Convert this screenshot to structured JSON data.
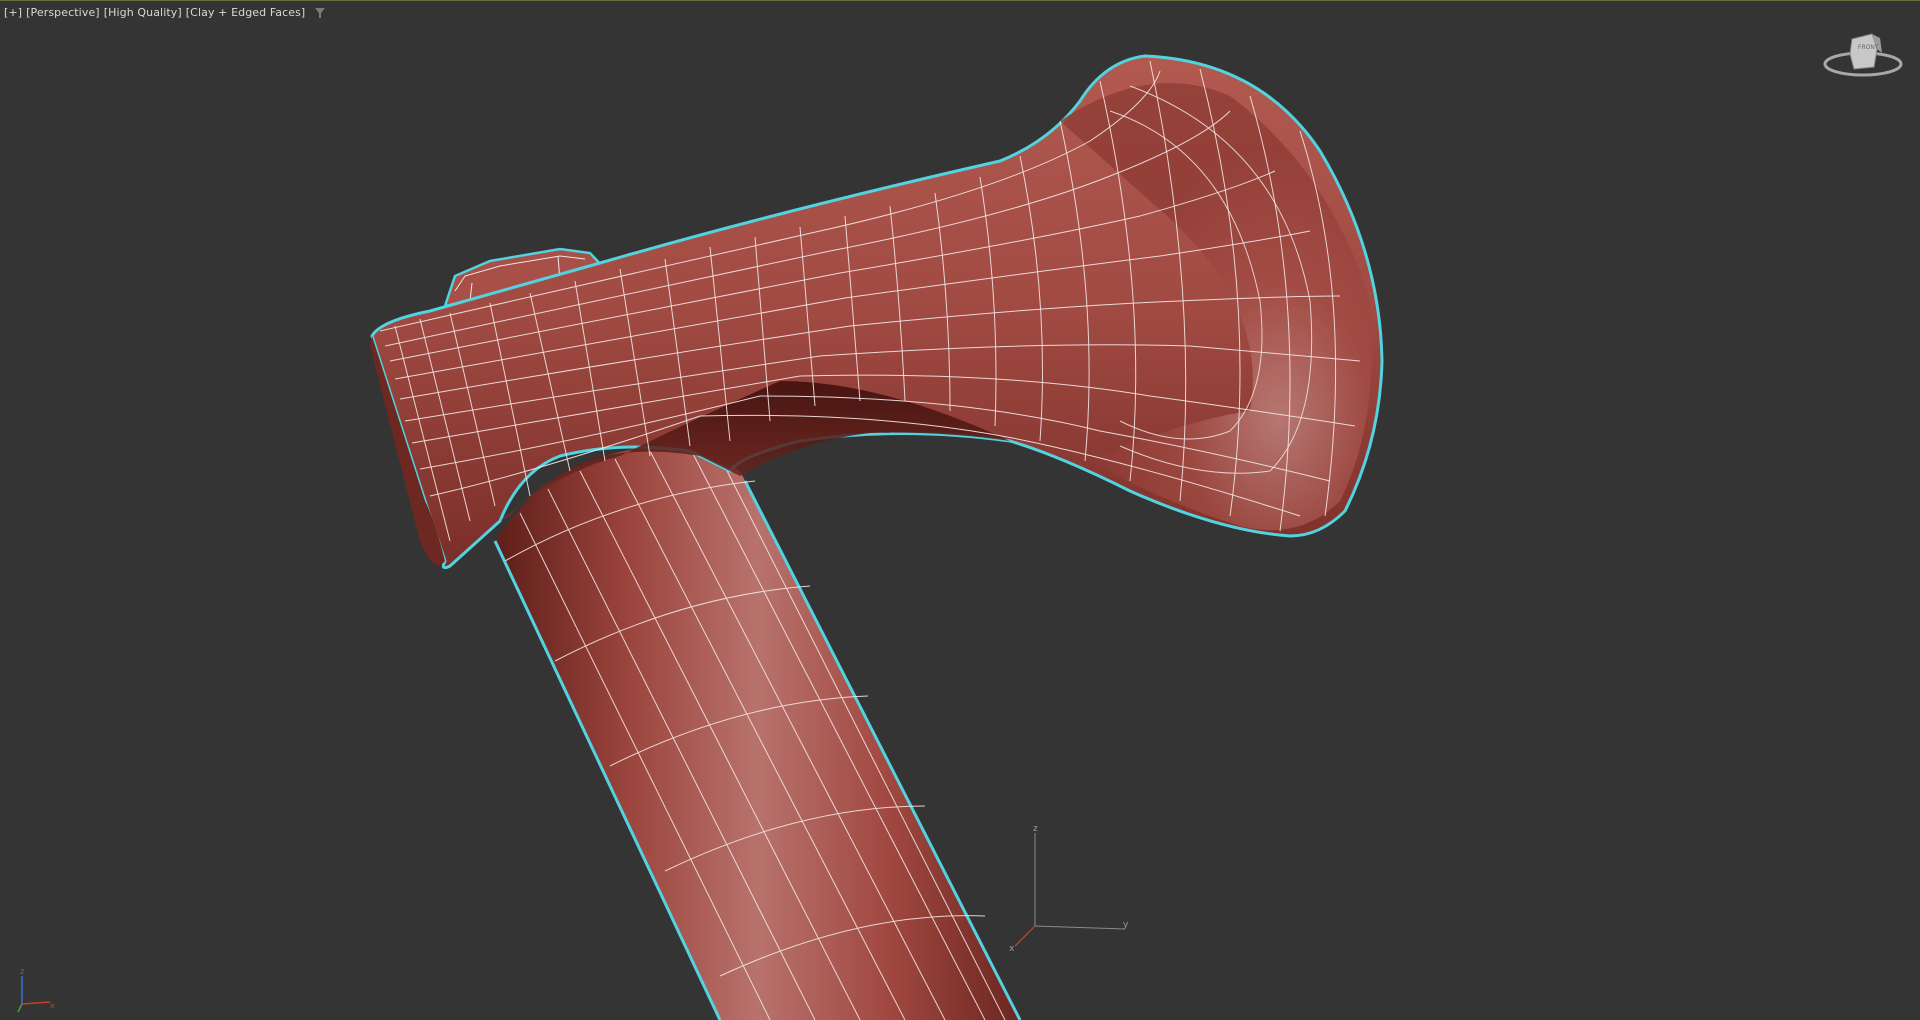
{
  "viewport": {
    "label_plus": "[+]",
    "label_view": "[Perspective]",
    "label_quality": "[High Quality]",
    "label_shading": "[Clay + Edged Faces]",
    "filter_icon": "filter-icon"
  },
  "viewcube": {
    "face_label": "FRONT"
  },
  "gizmo": {
    "x": "x",
    "y": "y",
    "z": "z"
  },
  "colors": {
    "background": "#343434",
    "clay": "#9c4a42",
    "wire": "#ffffff",
    "selection_outline": "#52d3e0"
  }
}
